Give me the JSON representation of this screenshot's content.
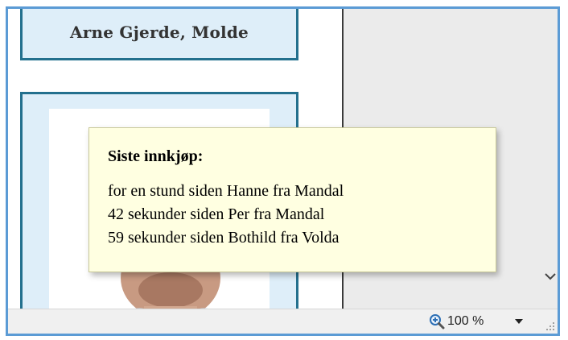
{
  "profile": {
    "name": "Arne Gjerde, Molde"
  },
  "tooltip": {
    "title": "Siste innkjøp:",
    "lines": [
      "for en stund siden Hanne fra Mandal",
      "42 sekunder siden Per fra Mandal",
      "59 sekunder siden Bothild fra Volda"
    ]
  },
  "statusbar": {
    "zoom_icon": "zoom-in-magnifier-icon",
    "zoom_level": "100 %",
    "dropdown_icon": "caret-down-icon",
    "grip_icon": "resize-grip-icon"
  },
  "colors": {
    "frame_border": "#5b9bd5",
    "card_border": "#23708e",
    "card_background": "#deeef9",
    "tooltip_background": "#ffffe1"
  }
}
